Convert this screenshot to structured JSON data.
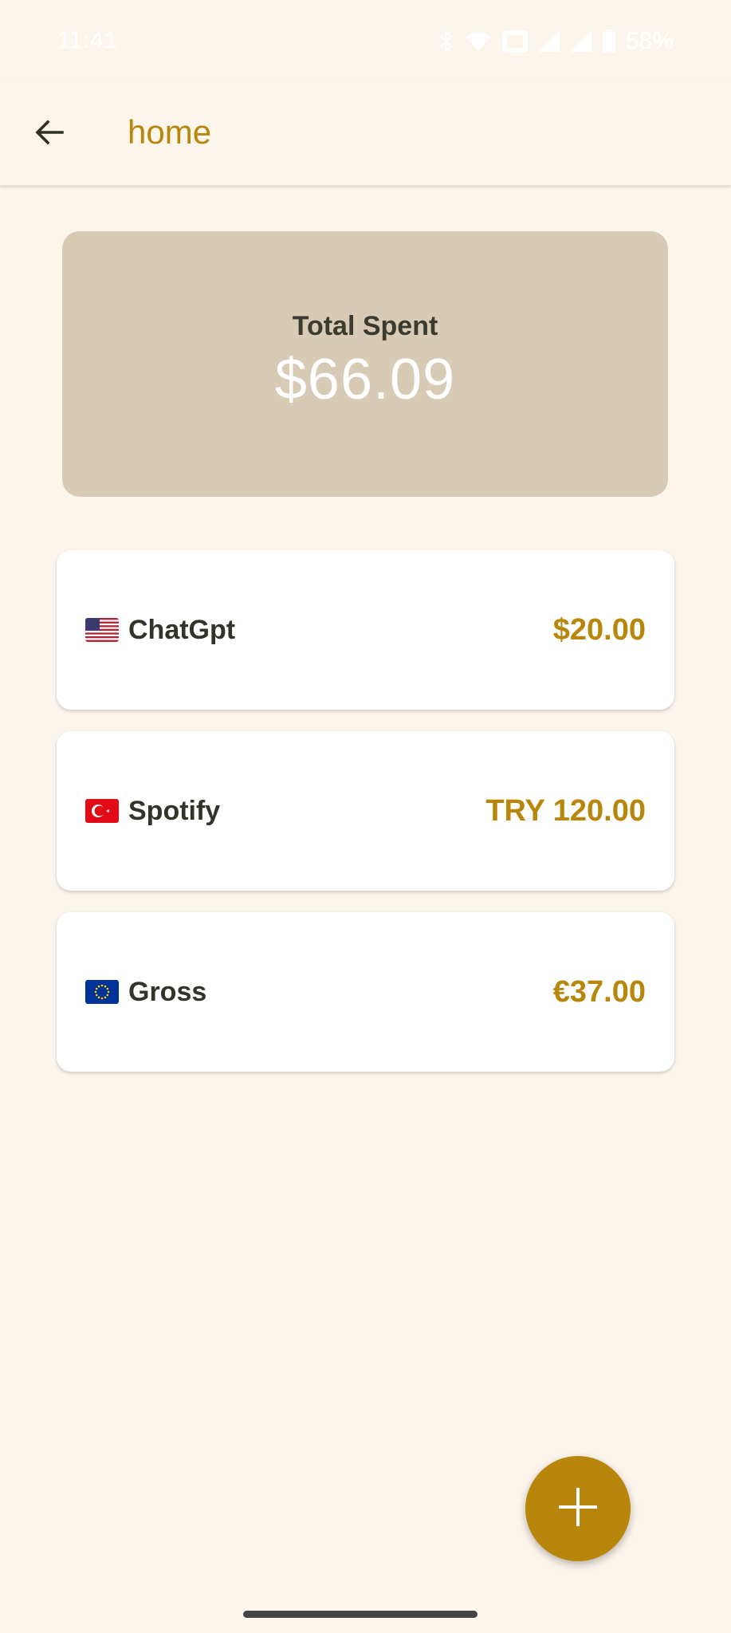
{
  "status_bar": {
    "time": "11:41",
    "battery": "58%",
    "icons": [
      "bluetooth-icon",
      "wifi-icon",
      "nfc-icon",
      "signal-icon",
      "signal-icon",
      "battery-icon"
    ]
  },
  "app_bar": {
    "title": "home",
    "back_icon": "arrow-left-icon"
  },
  "summary": {
    "label": "Total Spent",
    "value": "$66.09"
  },
  "subscriptions": [
    {
      "flag": "us-flag-icon",
      "name": "ChatGpt",
      "amount": "$20.00"
    },
    {
      "flag": "tr-flag-icon",
      "name": "Spotify",
      "amount": "TRY 120.00"
    },
    {
      "flag": "eu-flag-icon",
      "name": "Gross",
      "amount": "€37.00"
    }
  ],
  "fab": {
    "icon": "plus-icon"
  },
  "colors": {
    "background": "#FCF5EC",
    "accent": "#B8860B",
    "summary_card": "#D8CBB5",
    "text_dark": "#33332A",
    "card": "#FFFFFF"
  }
}
